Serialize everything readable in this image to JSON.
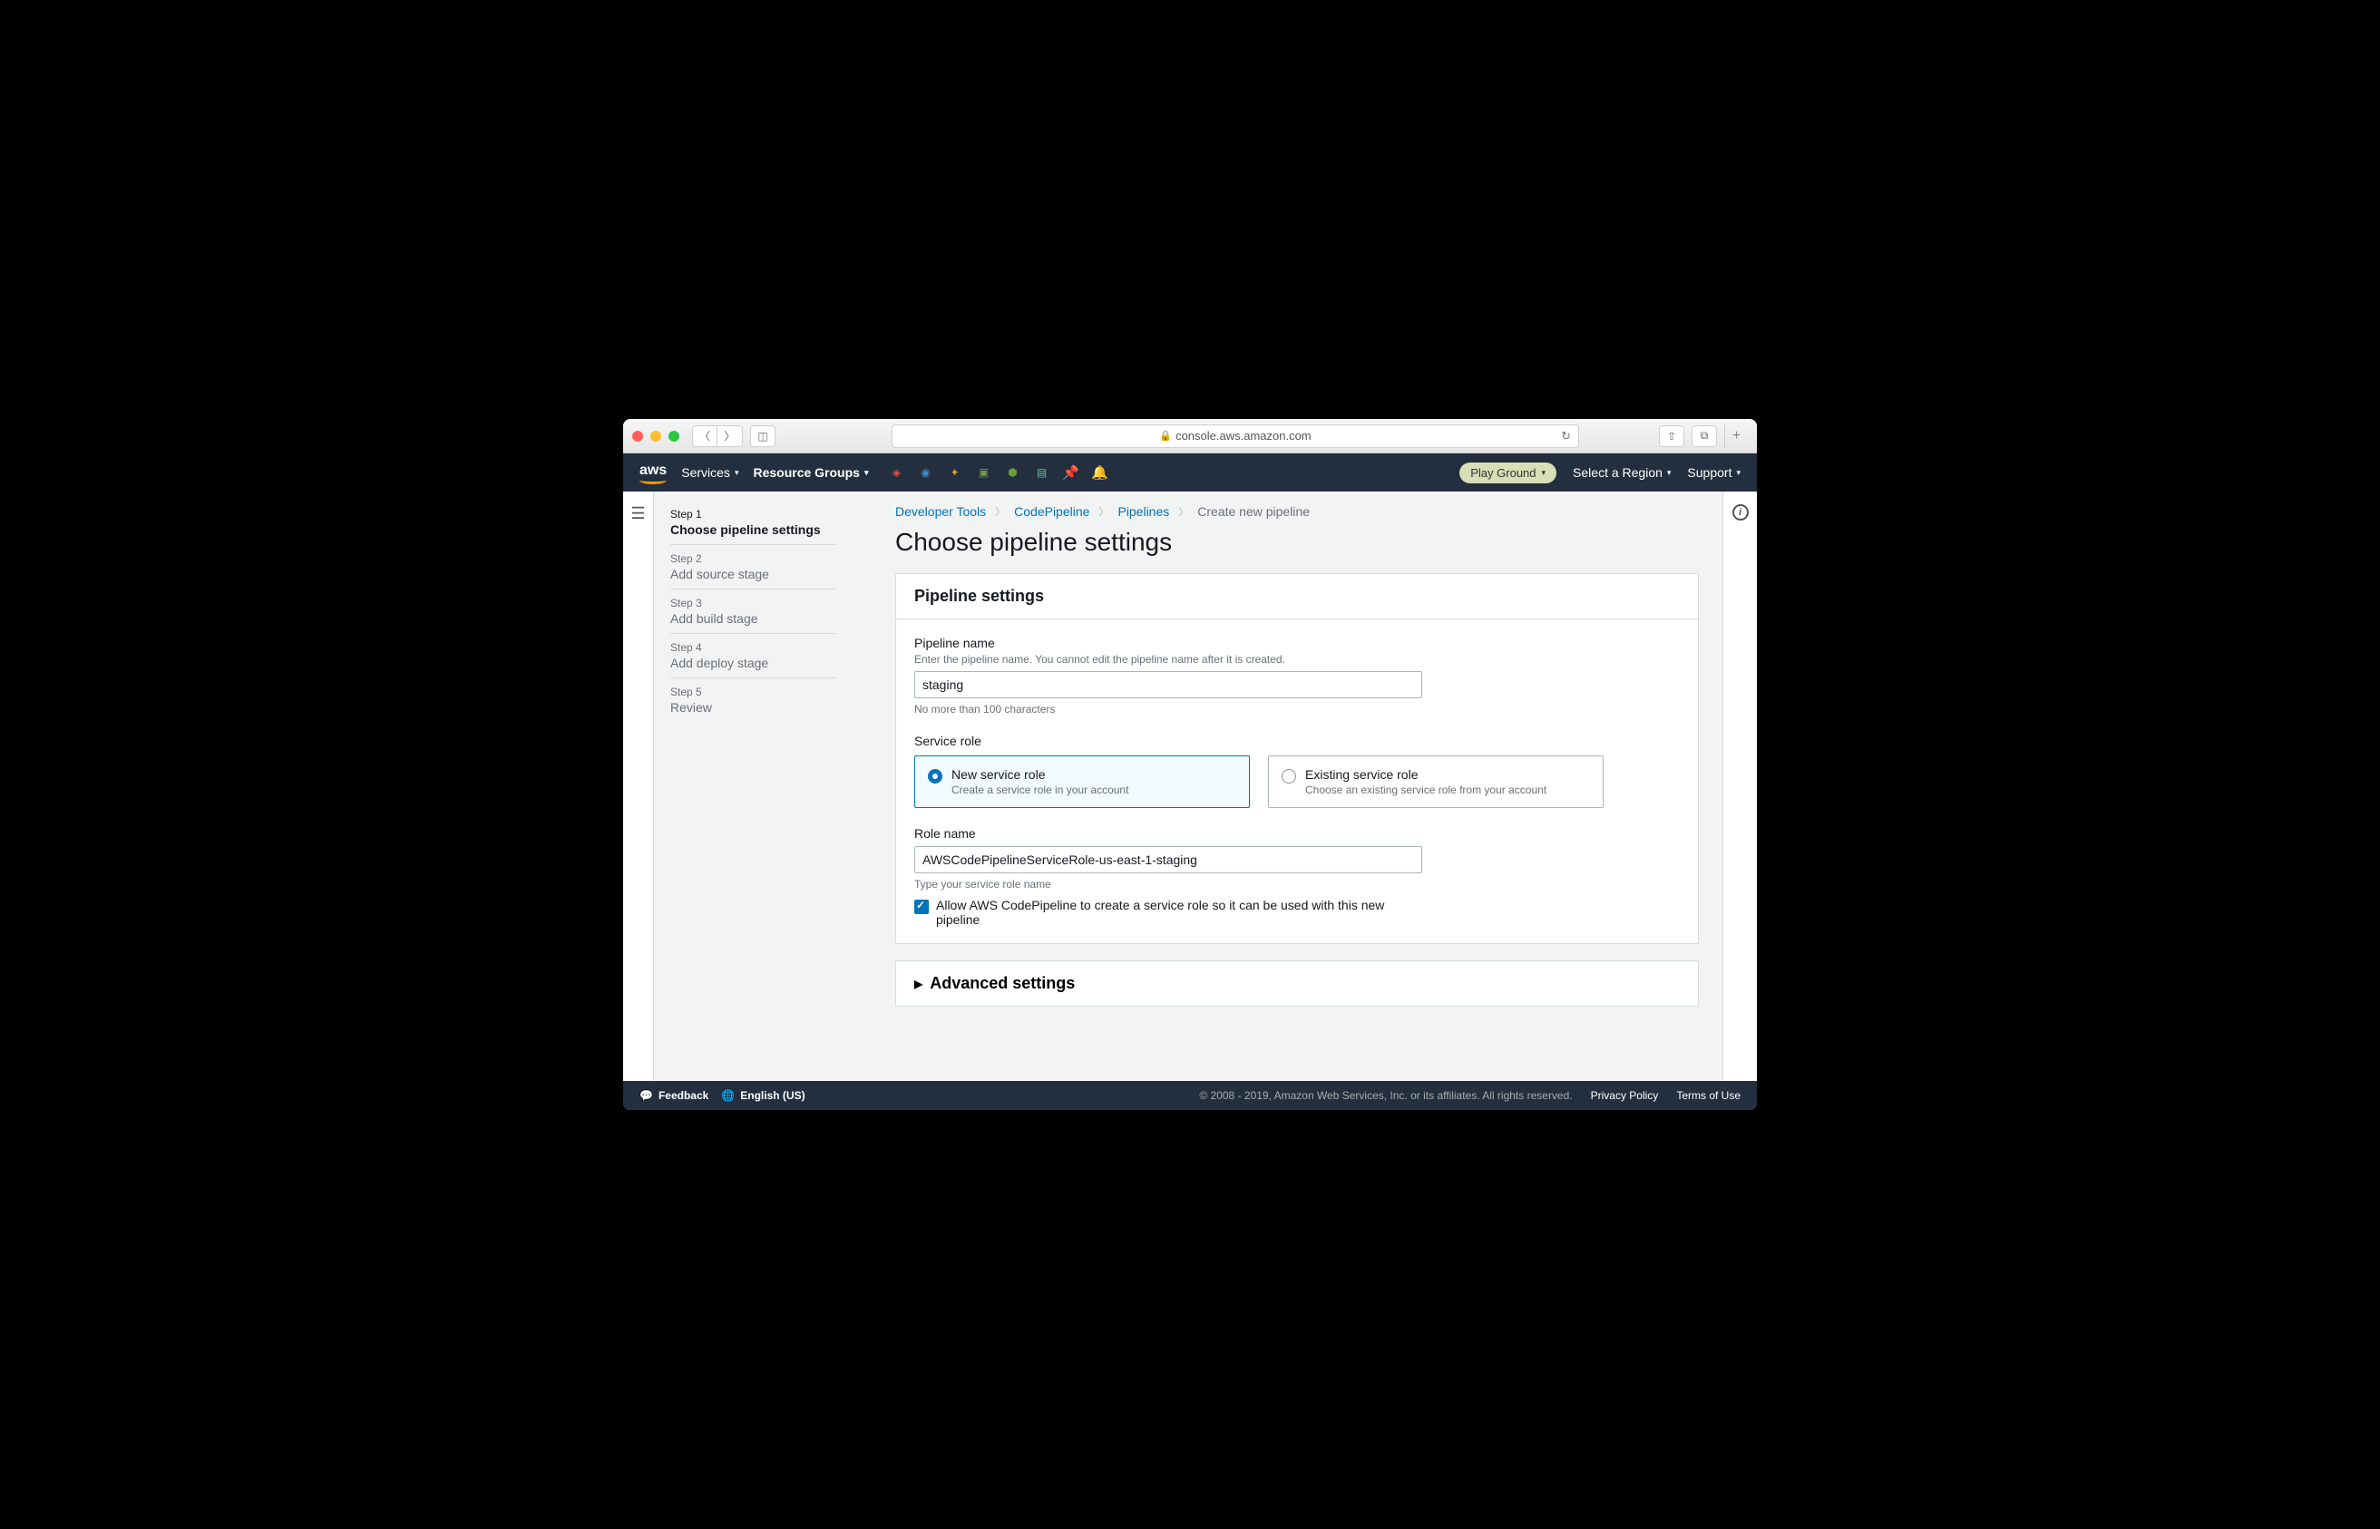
{
  "browser": {
    "url": "console.aws.amazon.com"
  },
  "nav": {
    "services": "Services",
    "resource_groups": "Resource Groups",
    "account": "Play Ground",
    "region": "Select a Region",
    "support": "Support"
  },
  "wizard": {
    "steps": [
      {
        "label": "Step 1",
        "title": "Choose pipeline settings"
      },
      {
        "label": "Step 2",
        "title": "Add source stage"
      },
      {
        "label": "Step 3",
        "title": "Add build stage"
      },
      {
        "label": "Step 4",
        "title": "Add deploy stage"
      },
      {
        "label": "Step 5",
        "title": "Review"
      }
    ]
  },
  "breadcrumbs": {
    "items": [
      "Developer Tools",
      "CodePipeline",
      "Pipelines"
    ],
    "current": "Create new pipeline"
  },
  "page": {
    "title": "Choose pipeline settings"
  },
  "panel": {
    "header": "Pipeline settings",
    "pipeline_name": {
      "label": "Pipeline name",
      "help": "Enter the pipeline name. You cannot edit the pipeline name after it is created.",
      "value": "staging",
      "hint": "No more than 100 characters"
    },
    "service_role": {
      "label": "Service role",
      "options": [
        {
          "title": "New service role",
          "desc": "Create a service role in your account"
        },
        {
          "title": "Existing service role",
          "desc": "Choose an existing service role from your account"
        }
      ]
    },
    "role_name": {
      "label": "Role name",
      "value": "AWSCodePipelineServiceRole-us-east-1-staging",
      "hint": "Type your service role name",
      "checkbox_label": "Allow AWS CodePipeline to create a service role so it can be used with this new pipeline"
    }
  },
  "advanced": {
    "title": "Advanced settings"
  },
  "footer": {
    "feedback": "Feedback",
    "language": "English (US)",
    "copyright": "© 2008 - 2019, Amazon Web Services, Inc. or its affiliates. All rights reserved.",
    "privacy": "Privacy Policy",
    "terms": "Terms of Use"
  }
}
